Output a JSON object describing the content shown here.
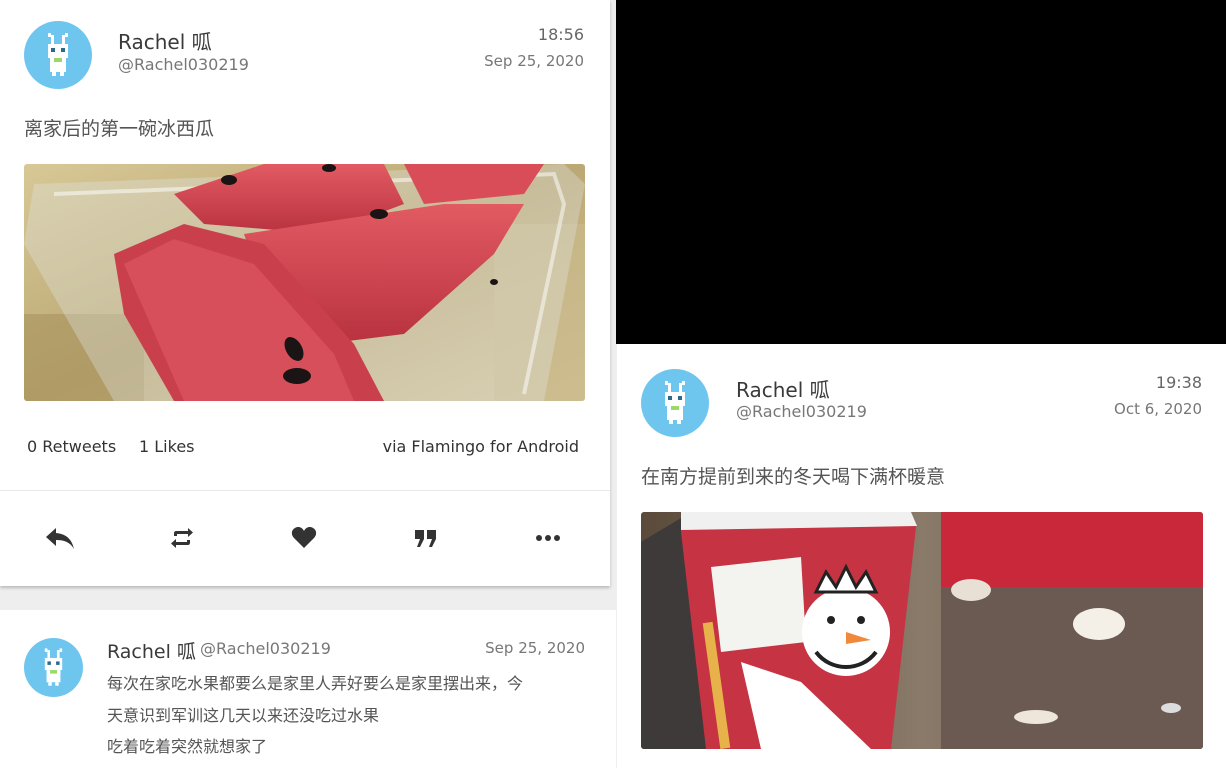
{
  "tweet1": {
    "name": "Rachel 呱",
    "handle": "@Rachel030219",
    "time": "18:56",
    "date": "Sep 25, 2020",
    "text": "离家后的第一碗冰西瓜",
    "retweets": "0 Retweets",
    "likes": "1 Likes",
    "via": "via Flamingo for Android",
    "actions": [
      "reply-icon",
      "retweet-icon",
      "heart-icon",
      "quote-icon",
      "more-icon"
    ]
  },
  "reply": {
    "name": "Rachel 呱",
    "handle": "@Rachel030219",
    "date": "Sep 25, 2020",
    "lines": [
      "每次在家吃水果都要么是家里人弄好要么是家里摆出来，今",
      "天意识到军训这几天以来还没吃过水果",
      "吃着吃着突然就想家了"
    ]
  },
  "tweet2": {
    "name": "Rachel 呱",
    "handle": "@Rachel030219",
    "time": "19:38",
    "date": "Oct 6, 2020",
    "text": "在南方提前到来的冬天喝下满杯暖意"
  },
  "colors": {
    "avatar_bg": "#6ec6ef",
    "text_primary": "#3a3a3a",
    "text_secondary": "#777777",
    "icon": "#333333"
  }
}
